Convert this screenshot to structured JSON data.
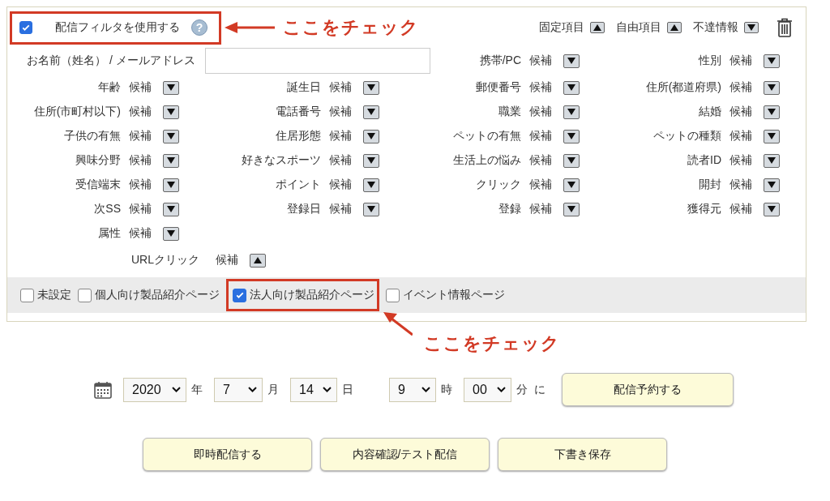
{
  "filter_toggle": {
    "label": "配信フィルタを使用する",
    "checked": true,
    "help": "?",
    "callout": "ここをチェック"
  },
  "header_toggles": [
    {
      "label": "固定項目",
      "expanded": true
    },
    {
      "label": "自由項目",
      "expanded": true
    },
    {
      "label": "不達情報",
      "expanded": false
    }
  ],
  "name_email": {
    "label": "お名前（姓名） / メールアドレス"
  },
  "first_row_fields": [
    {
      "label": "携帯/PC",
      "value": "候補",
      "expanded": false
    },
    {
      "label": "性別",
      "value": "候補",
      "expanded": false
    }
  ],
  "fields": [
    {
      "label": "年齢",
      "value": "候補",
      "expanded": false
    },
    {
      "label": "誕生日",
      "value": "候補",
      "expanded": false
    },
    {
      "label": "郵便番号",
      "value": "候補",
      "expanded": false
    },
    {
      "label": "住所(都道府県)",
      "value": "候補",
      "expanded": false
    },
    {
      "label": "住所(市町村以下)",
      "value": "候補",
      "expanded": false
    },
    {
      "label": "電話番号",
      "value": "候補",
      "expanded": false
    },
    {
      "label": "職業",
      "value": "候補",
      "expanded": false
    },
    {
      "label": "結婚",
      "value": "候補",
      "expanded": false
    },
    {
      "label": "子供の有無",
      "value": "候補",
      "expanded": false
    },
    {
      "label": "住居形態",
      "value": "候補",
      "expanded": false
    },
    {
      "label": "ペットの有無",
      "value": "候補",
      "expanded": false
    },
    {
      "label": "ペットの種類",
      "value": "候補",
      "expanded": false
    },
    {
      "label": "興味分野",
      "value": "候補",
      "expanded": false
    },
    {
      "label": "好きなスポーツ",
      "value": "候補",
      "expanded": false
    },
    {
      "label": "生活上の悩み",
      "value": "候補",
      "expanded": false
    },
    {
      "label": "読者ID",
      "value": "候補",
      "expanded": false
    },
    {
      "label": "受信端末",
      "value": "候補",
      "expanded": false
    },
    {
      "label": "ポイント",
      "value": "候補",
      "expanded": false
    },
    {
      "label": "クリック",
      "value": "候補",
      "expanded": false
    },
    {
      "label": "開封",
      "value": "候補",
      "expanded": false
    },
    {
      "label": "次SS",
      "value": "候補",
      "expanded": false
    },
    {
      "label": "登録日",
      "value": "候補",
      "expanded": false
    },
    {
      "label": "登録",
      "value": "候補",
      "expanded": false
    },
    {
      "label": "獲得元",
      "value": "候補",
      "expanded": false
    },
    {
      "label": "属性",
      "value": "候補",
      "expanded": false
    }
  ],
  "url_click": {
    "label": "URLクリック",
    "value": "候補",
    "expanded": true
  },
  "pages": [
    {
      "label": "未設定",
      "checked": false
    },
    {
      "label": "個人向け製品紹介ページ",
      "checked": false
    },
    {
      "label": "法人向け製品紹介ページ",
      "checked": true,
      "callout": "ここをチェック"
    },
    {
      "label": "イベント情報ページ",
      "checked": false
    }
  ],
  "schedule": {
    "year": "2020",
    "year_unit": "年",
    "month": "7",
    "month_unit": "月",
    "day": "14",
    "day_unit": "日",
    "hour": "9",
    "hour_unit": "時",
    "minute": "00",
    "minute_unit": "分",
    "suffix": "に",
    "button": "配信予約する"
  },
  "buttons": [
    "即時配信する",
    "内容確認/テスト配信",
    "下書き保存"
  ]
}
